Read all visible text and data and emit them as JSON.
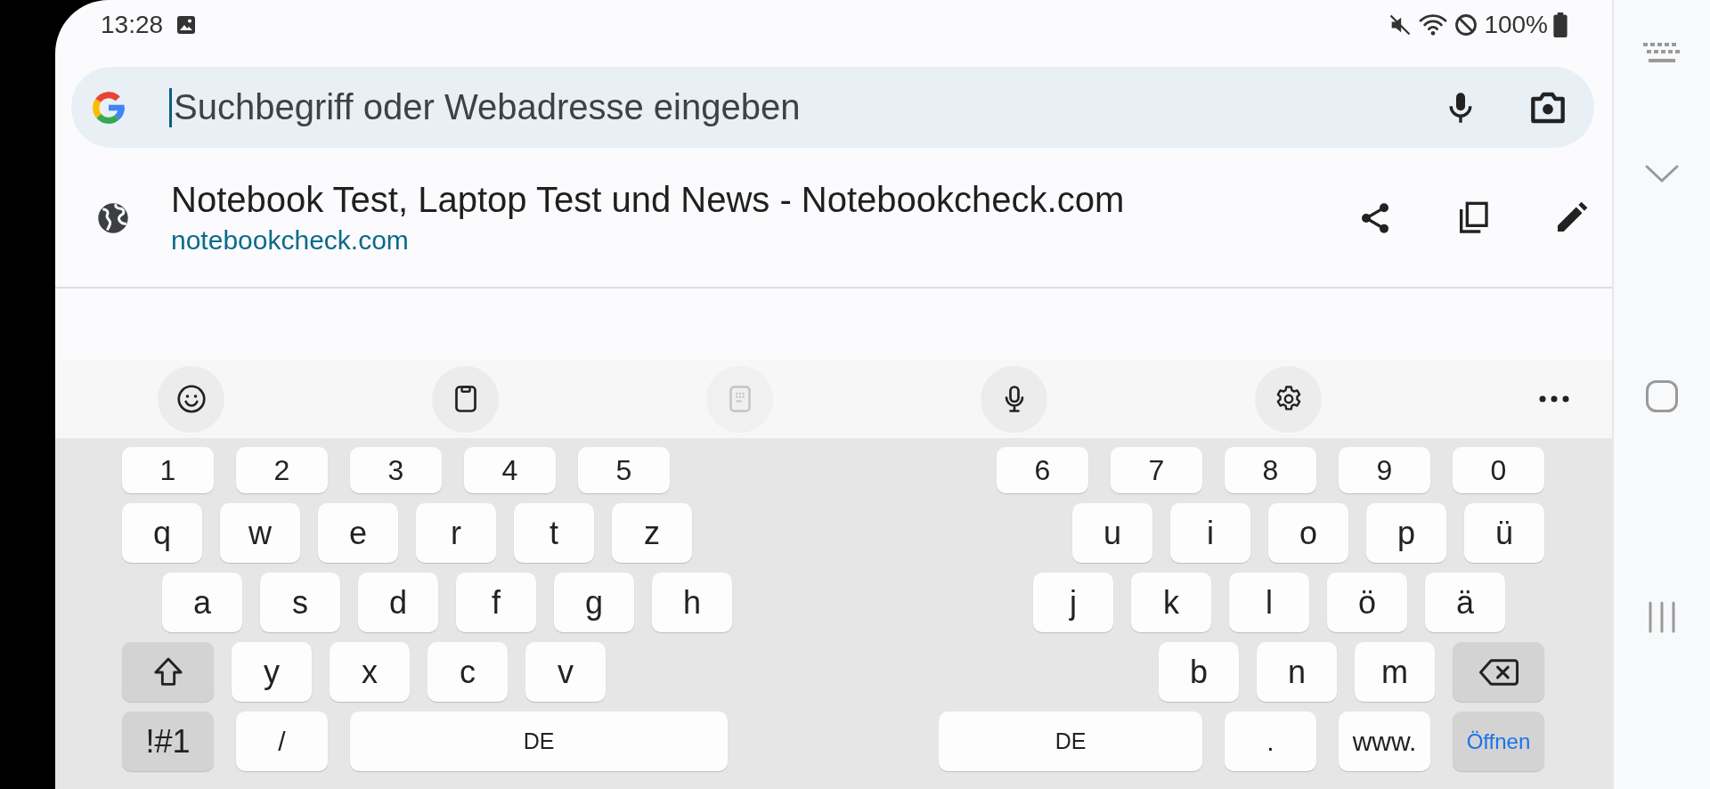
{
  "status_bar": {
    "time": "13:28",
    "battery": "100%"
  },
  "address_bar": {
    "placeholder": "Suchbegriff oder Webadresse eingeben"
  },
  "suggestion": {
    "title": "Notebook Test, Laptop Test und News - Notebookcheck.com",
    "url": "notebookcheck.com"
  },
  "keyboard_toolbar": [
    {
      "kind": "emoji",
      "disabled": false
    },
    {
      "kind": "clipboard",
      "disabled": false
    },
    {
      "kind": "keypad",
      "disabled": true
    },
    {
      "kind": "voice",
      "disabled": false
    },
    {
      "kind": "settings",
      "disabled": false
    },
    {
      "kind": "more",
      "disabled": false
    }
  ],
  "keyboard": {
    "left_rows": [
      [
        {
          "label": "1",
          "kind": "number"
        },
        {
          "label": "2",
          "kind": "number"
        },
        {
          "label": "3",
          "kind": "number"
        },
        {
          "label": "4",
          "kind": "number"
        },
        {
          "label": "5",
          "kind": "number"
        }
      ],
      [
        {
          "label": "q",
          "kind": "letter"
        },
        {
          "label": "w",
          "kind": "letter"
        },
        {
          "label": "e",
          "kind": "letter"
        },
        {
          "label": "r",
          "kind": "letter"
        },
        {
          "label": "t",
          "kind": "letter"
        },
        {
          "label": "z",
          "kind": "letter"
        }
      ],
      [
        {
          "label": "a",
          "kind": "letter"
        },
        {
          "label": "s",
          "kind": "letter"
        },
        {
          "label": "d",
          "kind": "letter"
        },
        {
          "label": "f",
          "kind": "letter"
        },
        {
          "label": "g",
          "kind": "letter"
        },
        {
          "label": "h",
          "kind": "letter"
        }
      ],
      [
        {
          "kind": "shift"
        },
        {
          "label": "y",
          "kind": "letter"
        },
        {
          "label": "x",
          "kind": "letter"
        },
        {
          "label": "c",
          "kind": "letter"
        },
        {
          "label": "v",
          "kind": "letter"
        }
      ],
      [
        {
          "label": "!#1",
          "kind": "symbols"
        },
        {
          "label": "/",
          "kind": "wide"
        },
        {
          "label": "DE",
          "kind": "space"
        }
      ]
    ],
    "right_rows": [
      [
        {
          "label": "6",
          "kind": "number"
        },
        {
          "label": "7",
          "kind": "number"
        },
        {
          "label": "8",
          "kind": "number"
        },
        {
          "label": "9",
          "kind": "number"
        },
        {
          "label": "0",
          "kind": "number"
        }
      ],
      [
        {
          "label": "u",
          "kind": "letter"
        },
        {
          "label": "i",
          "kind": "letter"
        },
        {
          "label": "o",
          "kind": "letter"
        },
        {
          "label": "p",
          "kind": "letter"
        },
        {
          "label": "ü",
          "kind": "letter"
        }
      ],
      [
        {
          "label": "j",
          "kind": "letter"
        },
        {
          "label": "k",
          "kind": "letter"
        },
        {
          "label": "l",
          "kind": "letter"
        },
        {
          "label": "ö",
          "kind": "letter"
        },
        {
          "label": "ä",
          "kind": "letter"
        }
      ],
      [
        {
          "label": "b",
          "kind": "letter"
        },
        {
          "label": "n",
          "kind": "letter"
        },
        {
          "label": "m",
          "kind": "letter"
        },
        {
          "kind": "backspace"
        }
      ],
      [
        {
          "label": "DE",
          "kind": "space"
        },
        {
          "label": ".",
          "kind": "wide"
        },
        {
          "label": "www.",
          "kind": "wide"
        },
        {
          "label": "Öffnen",
          "kind": "enter"
        }
      ]
    ]
  },
  "navigation_bar": [
    {
      "kind": "keyboard"
    },
    {
      "kind": "hide"
    },
    {
      "kind": "home"
    },
    {
      "kind": "recents"
    }
  ]
}
